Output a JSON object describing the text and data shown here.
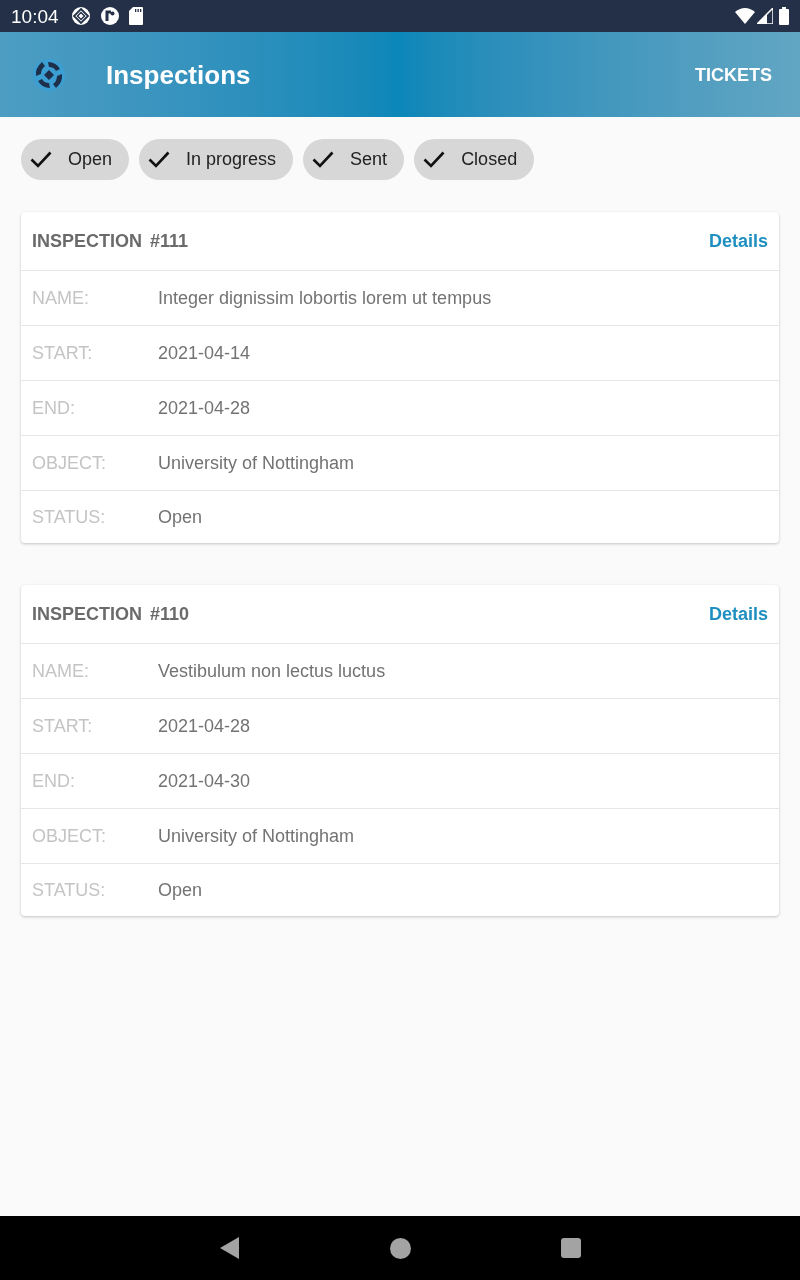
{
  "status_bar": {
    "time": "10:04"
  },
  "app_bar": {
    "title": "Inspections",
    "action": "TICKETS"
  },
  "filters": [
    {
      "label": "Open",
      "selected": true
    },
    {
      "label": "In progress",
      "selected": true
    },
    {
      "label": "Sent",
      "selected": true
    },
    {
      "label": "Closed",
      "selected": true
    }
  ],
  "inspections": [
    {
      "title": "INSPECTION",
      "number": "#111",
      "link": "Details",
      "fields": [
        {
          "label": "NAME:",
          "value": "Integer dignissim lobortis lorem ut tempus"
        },
        {
          "label": "START:",
          "value": "2021-04-14"
        },
        {
          "label": "END:",
          "value": "2021-04-28"
        },
        {
          "label": "OBJECT:",
          "value": "University of Nottingham"
        },
        {
          "label": "STATUS:",
          "value": "Open"
        }
      ]
    },
    {
      "title": "INSPECTION",
      "number": "#110",
      "link": "Details",
      "fields": [
        {
          "label": "NAME:",
          "value": "Vestibulum non lectus luctus"
        },
        {
          "label": "START:",
          "value": "2021-04-28"
        },
        {
          "label": "END:",
          "value": "2021-04-30"
        },
        {
          "label": "OBJECT:",
          "value": "University of Nottingham"
        },
        {
          "label": "STATUS:",
          "value": "Open"
        }
      ]
    }
  ]
}
